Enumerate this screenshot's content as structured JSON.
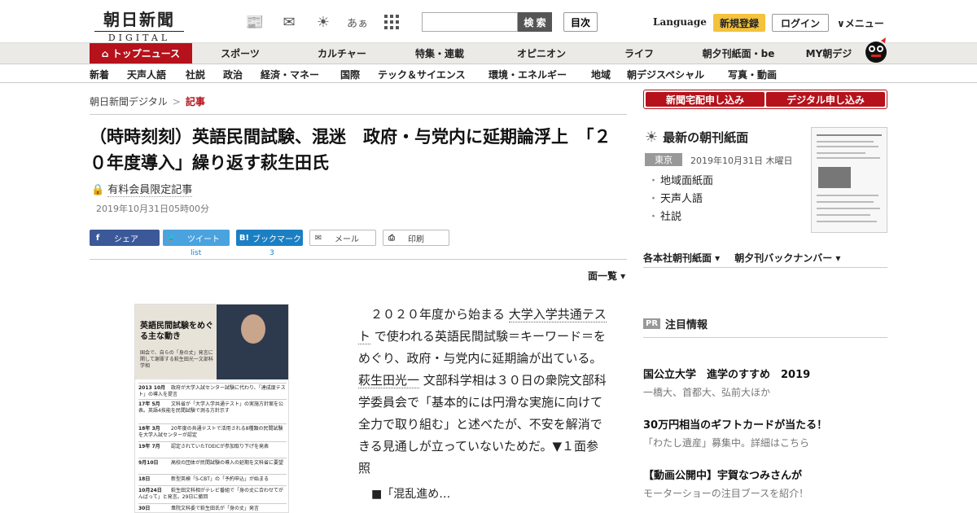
{
  "header": {
    "logo_main": "朝日新聞",
    "logo_sub": "DIGITAL",
    "tool_icons": [
      "📰",
      "✉",
      "☀",
      "あぁ",
      "⋮⋮"
    ],
    "search_placeholder": "",
    "search_label": "検 索",
    "toc_label": "目次",
    "language_label": "Language",
    "register_label": "新規登録",
    "login_label": "ログイン",
    "menu_label": "∨メニュー"
  },
  "main_nav": {
    "items": [
      "トップニュース",
      "スポーツ",
      "カルチャー",
      "特集・連載",
      "オピニオン",
      "ライフ",
      "朝夕刊紙面・be",
      "MY朝デジ"
    ],
    "active_index": 0
  },
  "sub_nav": {
    "items": [
      "新着",
      "天声人語",
      "社説",
      "政治",
      "経済・マネー",
      "国際",
      "テック＆サイエンス",
      "環境・エネルギー",
      "地域",
      "朝デジスペシャル",
      "写真・動画"
    ]
  },
  "breadcrumb": {
    "home": "朝日新聞デジタル",
    "separator": ">",
    "current": "記事"
  },
  "article": {
    "headline": "（時時刻刻）英語民間試験、混迷　政府・与党内に延期論浮上　「２０年度導入」繰り返す萩生田氏",
    "paid_label": "有料会員限定記事",
    "date": "2019年10月31日05時00分",
    "page_list_label": "面一覧 ▾",
    "body_parts": [
      {
        "text": "　２０２０年度から始まる "
      },
      {
        "text": "大学入学共通テスト",
        "link": true
      },
      {
        "text": " で使われる英語民間試験＝キーワード＝をめぐり、政府・与党内に延期論が出ている。 "
      },
      {
        "text": "萩生田光一",
        "link": true
      },
      {
        "text": " 文部科学相は３０日の衆院文部科学委員会で「基本的には円滑な実施に向けて全力で取り組む」と述べたが、不安を解消できる見通しが立っていないためだ。▼１面参照"
      }
    ],
    "bullet": "■「混乱進め…"
  },
  "share": {
    "facebook": "シェア",
    "twitter": "ツイート",
    "twitter_count": "list",
    "bookmark": "ブックマーク",
    "bookmark_count": "3",
    "mail": "メール",
    "print": "印刷"
  },
  "photo": {
    "heading": "英語民間試験をめぐる主な動き",
    "sub": "国会で、自らの「身の丈」発言に関して謝罪する萩生田光一文部科学相",
    "timeline": [
      {
        "date": "2013 10月",
        "text": "政府が大学入試センター試験に代わり、「達成度テスト」の導入を提言"
      },
      {
        "date": "17年 5月",
        "text": "文科省が「大学入学共通テスト」の実施方針案を公表。英語4技能を民間試験で測る方針示す"
      },
      {
        "date": "18年 3月",
        "text": "20年度の共通テストで活用される8種類の民間試験を大学入試センターが認定"
      },
      {
        "date": "19年 7月",
        "text": "認定されていたTOEICが参加取り下げを発表"
      },
      {
        "date": "9月10日",
        "text": "高校の団体が民間試験の導入の延期を文科省に要望"
      },
      {
        "date": "18日",
        "text": "新型英検「S-CBT」の「予約申込」が始まる"
      },
      {
        "date": "10月24日",
        "text": "萩生田文科相がテレビ番組で「身の丈に合わせてがんばって」と発言。29日に撤回"
      },
      {
        "date": "30日",
        "text": "衆院文科委で萩生田氏が「身の丈」発言"
      }
    ]
  },
  "sidebar": {
    "btn_home_delivery": "新聞宅配申し込み",
    "btn_digital": "デジタル申し込み",
    "morning_title": "最新の朝刊紙面",
    "region": "東京",
    "paper_date": "2019年10月31日 木曜日",
    "paper_links": [
      "地域面紙面",
      "天声人語",
      "社説"
    ],
    "side_links": [
      "各本社朝刊紙面 ▾",
      "朝夕刊バックナンバー ▾"
    ],
    "pr_badge": "PR",
    "pr_title": "注目情報",
    "pr_items": [
      {
        "title": "国公立大学　進学のすすめ　2019",
        "desc": "一橋大、首都大、弘前大ほか"
      },
      {
        "title": "30万円相当のギフトカードが当たる！",
        "desc": "「わたし遺産」募集中。詳細はこちら"
      },
      {
        "title": "【動画公開中】宇賀なつみさんが",
        "desc": "モーターショーの注目ブースを紹介！"
      }
    ]
  },
  "colors": {
    "brand_red": "#b5121b",
    "register_yellow": "#f4c23c",
    "facebook": "#3b5998",
    "twitter": "#4aa3df",
    "bookmark": "#1b7fc4"
  }
}
